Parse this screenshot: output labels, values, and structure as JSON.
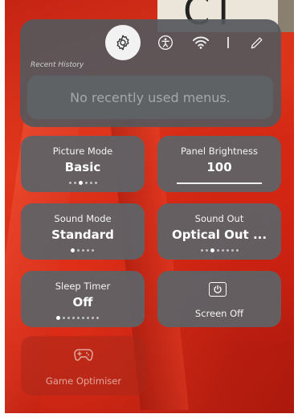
{
  "background": {
    "sign_text": "CT"
  },
  "quick_settings": {
    "icons": [
      "gear-icon",
      "accessibility-icon",
      "wifi-icon",
      "pencil-icon"
    ],
    "recent_history": {
      "label": "Recent History",
      "empty_text": "No recently used menus."
    },
    "tiles": [
      {
        "id": "picture-mode",
        "title": "Picture Mode",
        "value": "Basic",
        "dots_total": 6,
        "dot_active": 2
      },
      {
        "id": "panel-brightness",
        "title": "Panel Brightness",
        "value": "100",
        "level_percent": 100
      },
      {
        "id": "sound-mode",
        "title": "Sound Mode",
        "value": "Standard",
        "dots_total": 5,
        "dot_active": 0
      },
      {
        "id": "sound-out",
        "title": "Sound Out",
        "value": "Optical Out ...",
        "dots_total": 8,
        "dot_active": 2
      },
      {
        "id": "sleep-timer",
        "title": "Sleep Timer",
        "value": "Off",
        "dots_total": 9,
        "dot_active": 0
      },
      {
        "id": "screen-off",
        "title": "Screen Off",
        "icon": "power-icon"
      }
    ],
    "game_optimiser": {
      "label": "Game Optimiser",
      "icon": "gamepad-icon"
    }
  },
  "colors": {
    "panel": "#55585c",
    "tile": "#5f6266",
    "active_icon_bg": "#f2f2f2",
    "background_red": "#d42512"
  }
}
